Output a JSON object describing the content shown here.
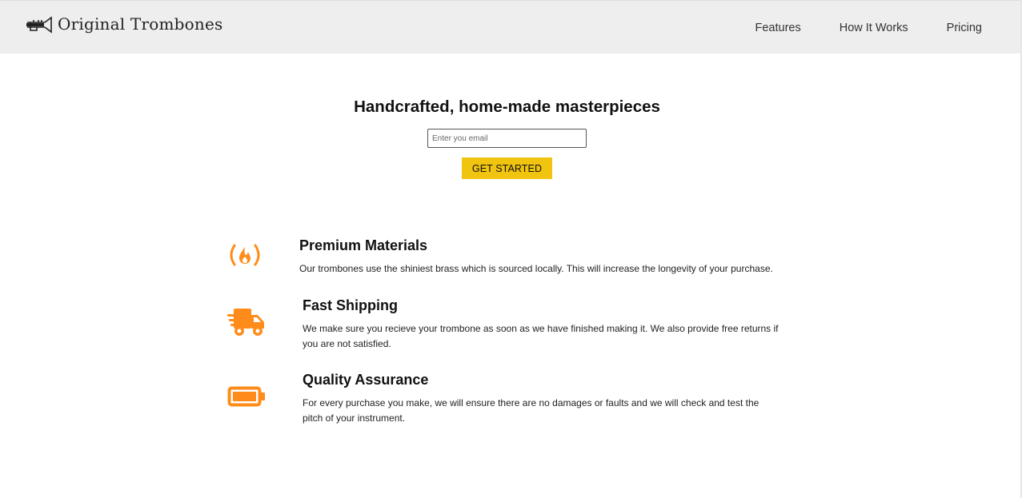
{
  "header": {
    "brand": "Original Trombones",
    "logo_icon": "trombone-icon",
    "nav": [
      {
        "label": "Features"
      },
      {
        "label": "How It Works"
      },
      {
        "label": "Pricing"
      }
    ]
  },
  "hero": {
    "title": "Handcrafted, home-made masterpieces",
    "email_placeholder": "Enter you email",
    "cta_label": "GET STARTED"
  },
  "features": [
    {
      "icon": "fire-icon",
      "title": "Premium Materials",
      "text": "Our trombones use the shiniest brass which is sourced locally. This will increase the longevity of your purchase."
    },
    {
      "icon": "truck-icon",
      "title": "Fast Shipping",
      "text": "We make sure you recieve your trombone as soon as we have finished making it. We also provide free returns if you are not satisfied."
    },
    {
      "icon": "battery-icon",
      "title": "Quality Assurance",
      "text": "For every purchase you make, we will ensure there are no damages or faults and we will check and test the pitch of your instrument."
    }
  ],
  "colors": {
    "accent": "#f1c40f",
    "icon": "#ff8c1a",
    "header_bg": "#eeeeee"
  }
}
